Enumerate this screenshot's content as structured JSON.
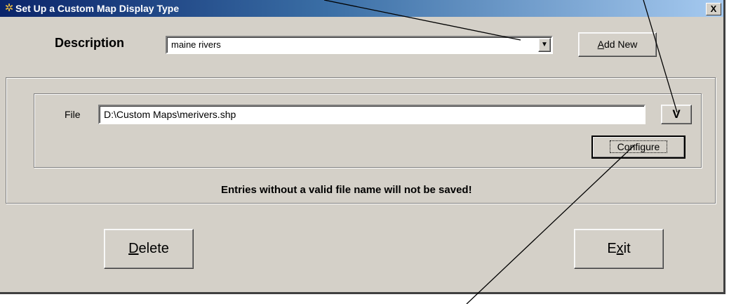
{
  "window": {
    "title": "Set Up a Custom Map Display Type",
    "close_label": "X"
  },
  "description": {
    "label": "Description",
    "value": "maine rivers",
    "dropdown_arrow": "▼",
    "add_new_first": "A",
    "add_new_rest": "dd New"
  },
  "file": {
    "label": "File",
    "value": "D:\\Custom Maps\\merivers.shp",
    "browse_label": "V",
    "configure_label": "Configure"
  },
  "warning": "Entries without a valid file name will not be saved!",
  "buttons": {
    "delete_first": "D",
    "delete_rest": "elete",
    "exit_first": "E",
    "exit_mid": "x",
    "exit_rest": "it"
  },
  "icons": {
    "title": "app-icon",
    "close": "close-icon",
    "dropdown": "chevron-down-icon"
  }
}
